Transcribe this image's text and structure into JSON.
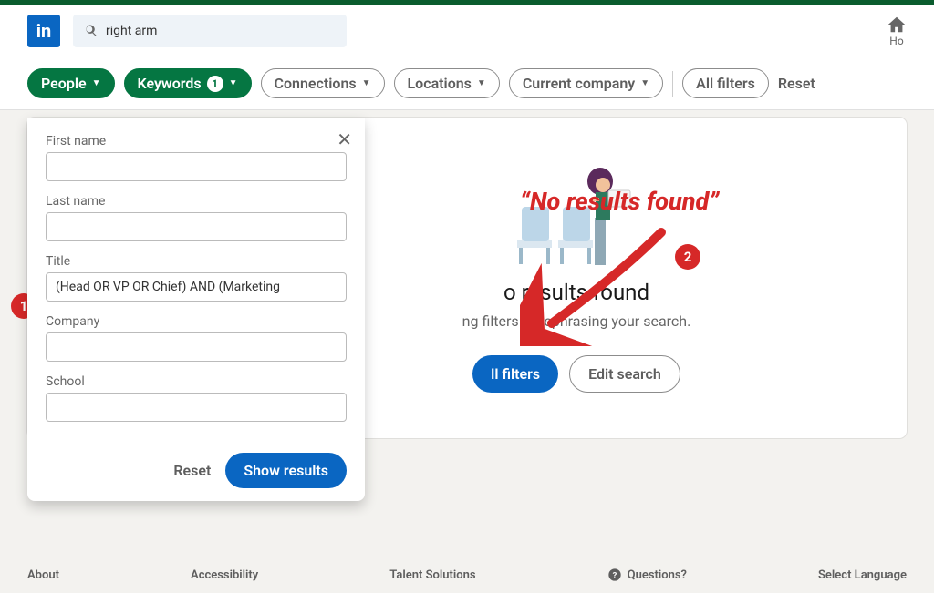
{
  "header": {
    "search_value": "right arm",
    "home_label": "Ho"
  },
  "filters": {
    "people": "People",
    "keywords": "Keywords",
    "keywords_count": "1",
    "connections": "Connections",
    "locations": "Locations",
    "current_company": "Current company",
    "all_filters": "All filters",
    "reset": "Reset"
  },
  "dropdown": {
    "first_name_label": "First name",
    "first_name_value": "",
    "last_name_label": "Last name",
    "last_name_value": "",
    "title_label": "Title",
    "title_value": "(Head OR VP OR Chief) AND (Marketing",
    "company_label": "Company",
    "company_value": "",
    "school_label": "School",
    "school_value": "",
    "reset": "Reset",
    "show": "Show results"
  },
  "results": {
    "title": "No results found",
    "title_partial": "o results found",
    "sub_partial": "ng filters or rephrasing your search.",
    "clear_btn_partial": "ll filters",
    "edit_btn": "Edit search"
  },
  "annotations": {
    "quote": "“No results found”",
    "badge1": "1",
    "badge2": "2"
  },
  "footer": {
    "about": "About",
    "accessibility": "Accessibility",
    "talent": "Talent Solutions",
    "questions": "Questions?",
    "lang": "Select Language"
  }
}
